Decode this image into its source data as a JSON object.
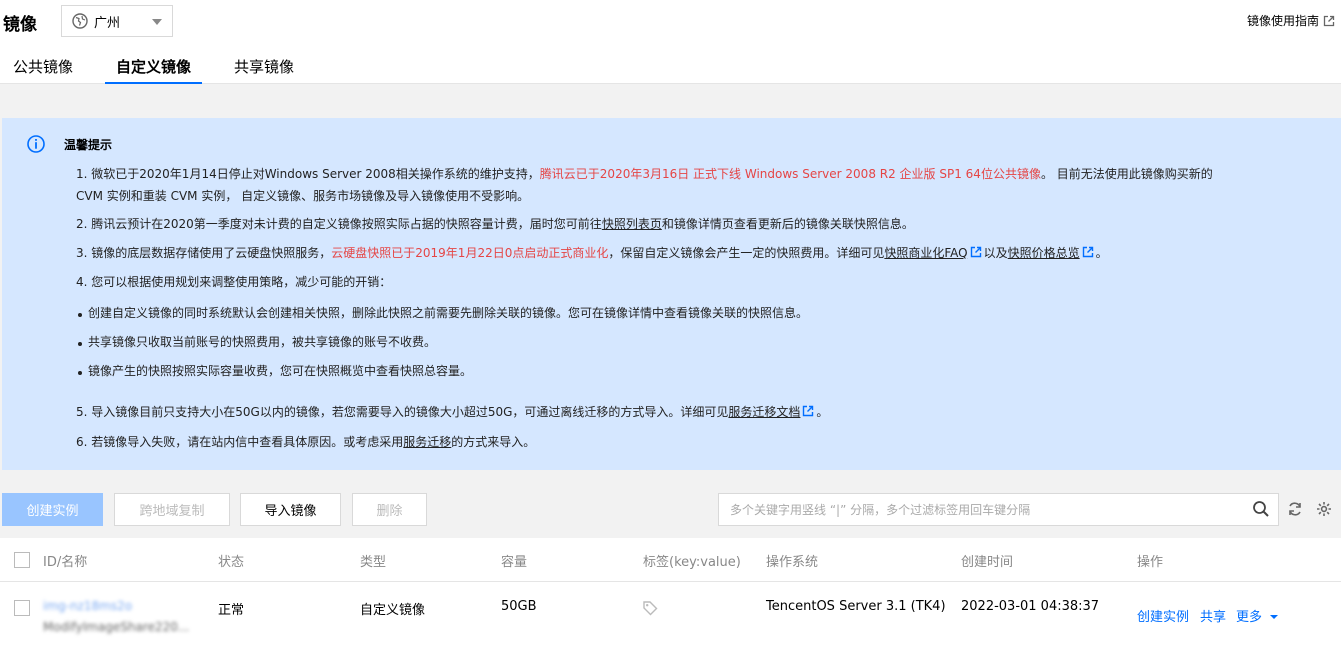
{
  "header": {
    "title": "镜像",
    "region": "广州",
    "guide_link": "镜像使用指南"
  },
  "tabs": [
    {
      "label": "公共镜像"
    },
    {
      "label": "自定义镜像",
      "active": true
    },
    {
      "label": "共享镜像"
    }
  ],
  "notice": {
    "title": "温馨提示",
    "l1a": "1. 微软已于2020年1月14日停止对Windows Server 2008相关操作系统的维护支持，",
    "l1red": "腾讯云已于2020年3月16日 正式下线 Windows Server 2008 R2 企业版 SP1 64位公共镜像",
    "l1b": "。 目前无法使用此镜像购买新的",
    "l1c": "CVM 实例和重装 CVM 实例， 自定义镜像、服务市场镜像及导入镜像使用不受影响。",
    "l2a": "2. 腾讯云预计在2020第一季度对未计费的自定义镜像按照实际占据的快照容量计费，届时您可前往",
    "l2link": "快照列表页",
    "l2b": "和镜像详情页查看更新后的镜像关联快照信息。",
    "l3a": "3. 镜像的底层数据存储使用了云硬盘快照服务，",
    "l3red": "云硬盘快照已于2019年1月22日0点启动正式商业化",
    "l3b": "，保留自定义镜像会产生一定的快照费用。详细可见",
    "l3link1": "快照商业化FAQ",
    "l3c": "以及",
    "l3link2": "快照价格总览",
    "l3d": "。",
    "l4": "4. 您可以根据使用规划来调整使用策略，减少可能的开销：",
    "b1": "创建自定义镜像的同时系统默认会创建相关快照，删除此快照之前需要先删除关联的镜像。您可在镜像详情中查看镜像关联的快照信息。",
    "b2": "共享镜像只收取当前账号的快照费用，被共享镜像的账号不收费。",
    "b3": "镜像产生的快照按照实际容量收费，您可在快照概览中查看快照总容量。",
    "l5a": "5. 导入镜像目前只支持大小在50G以内的镜像，若您需要导入的镜像大小超过50G，可通过离线迁移的方式导入。详细可见",
    "l5link": "服务迁移文档",
    "l5b": "。",
    "l6a": "6. 若镜像导入失败，请在站内信中查看具体原因。或考虑采用",
    "l6link": "服务迁移",
    "l6b": "的方式来导入。"
  },
  "toolbar": {
    "create_instance": "创建实例",
    "cross_region_copy": "跨地域复制",
    "import_image": "导入镜像",
    "delete": "删除",
    "search_placeholder": "多个关键字用竖线 “|” 分隔，多个过滤标签用回车键分隔"
  },
  "table": {
    "columns": [
      "ID/名称",
      "状态",
      "类型",
      "容量",
      "标签(key:value)",
      "操作系统",
      "创建时间",
      "操作"
    ],
    "rows": [
      {
        "id": "img-nz18ms2o",
        "name": "ModifyImageShare220...",
        "status": "正常",
        "type": "自定义镜像",
        "capacity": "50GB",
        "os": "TencentOS Server 3.1 (TK4)",
        "created": "2022-03-01 04:38:37",
        "actions": {
          "create": "创建实例",
          "share": "共享",
          "more": "更多"
        }
      }
    ]
  },
  "colors": {
    "accent": "#006eff",
    "notice_bg": "#d5e7ff",
    "warn_red": "#e54545"
  }
}
